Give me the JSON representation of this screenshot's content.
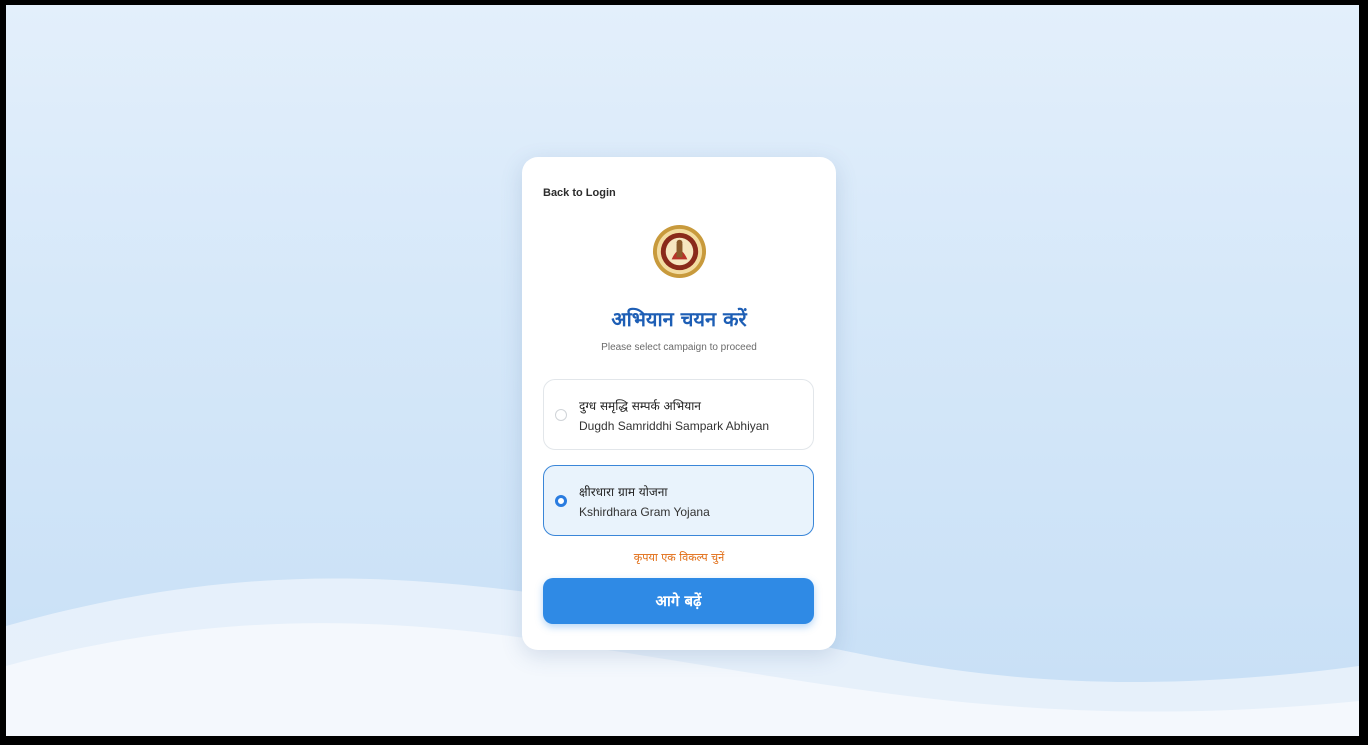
{
  "nav": {
    "back_label": "Back to Login"
  },
  "header": {
    "title": "अभियान चयन करें",
    "subtitle": "Please select campaign to proceed"
  },
  "options": [
    {
      "label_hi": "दुग्ध समृद्धि सम्पर्क अभियान",
      "label_en": "Dugdh Samriddhi Sampark Abhiyan",
      "selected": false
    },
    {
      "label_hi": "क्षीरधारा ग्राम योजना",
      "label_en": "Kshirdhara Gram Yojana",
      "selected": true
    }
  ],
  "validation": {
    "message": "कृपया एक विकल्प चुनें"
  },
  "actions": {
    "proceed_label": "आगे बढ़ें"
  },
  "colors": {
    "accent": "#2f8ae5",
    "title": "#1d5eb5",
    "warning": "#e06a10",
    "selected_bg": "#e9f3fc"
  },
  "icons": {
    "emblem": "government-emblem-icon",
    "radio": "radio-icon"
  }
}
